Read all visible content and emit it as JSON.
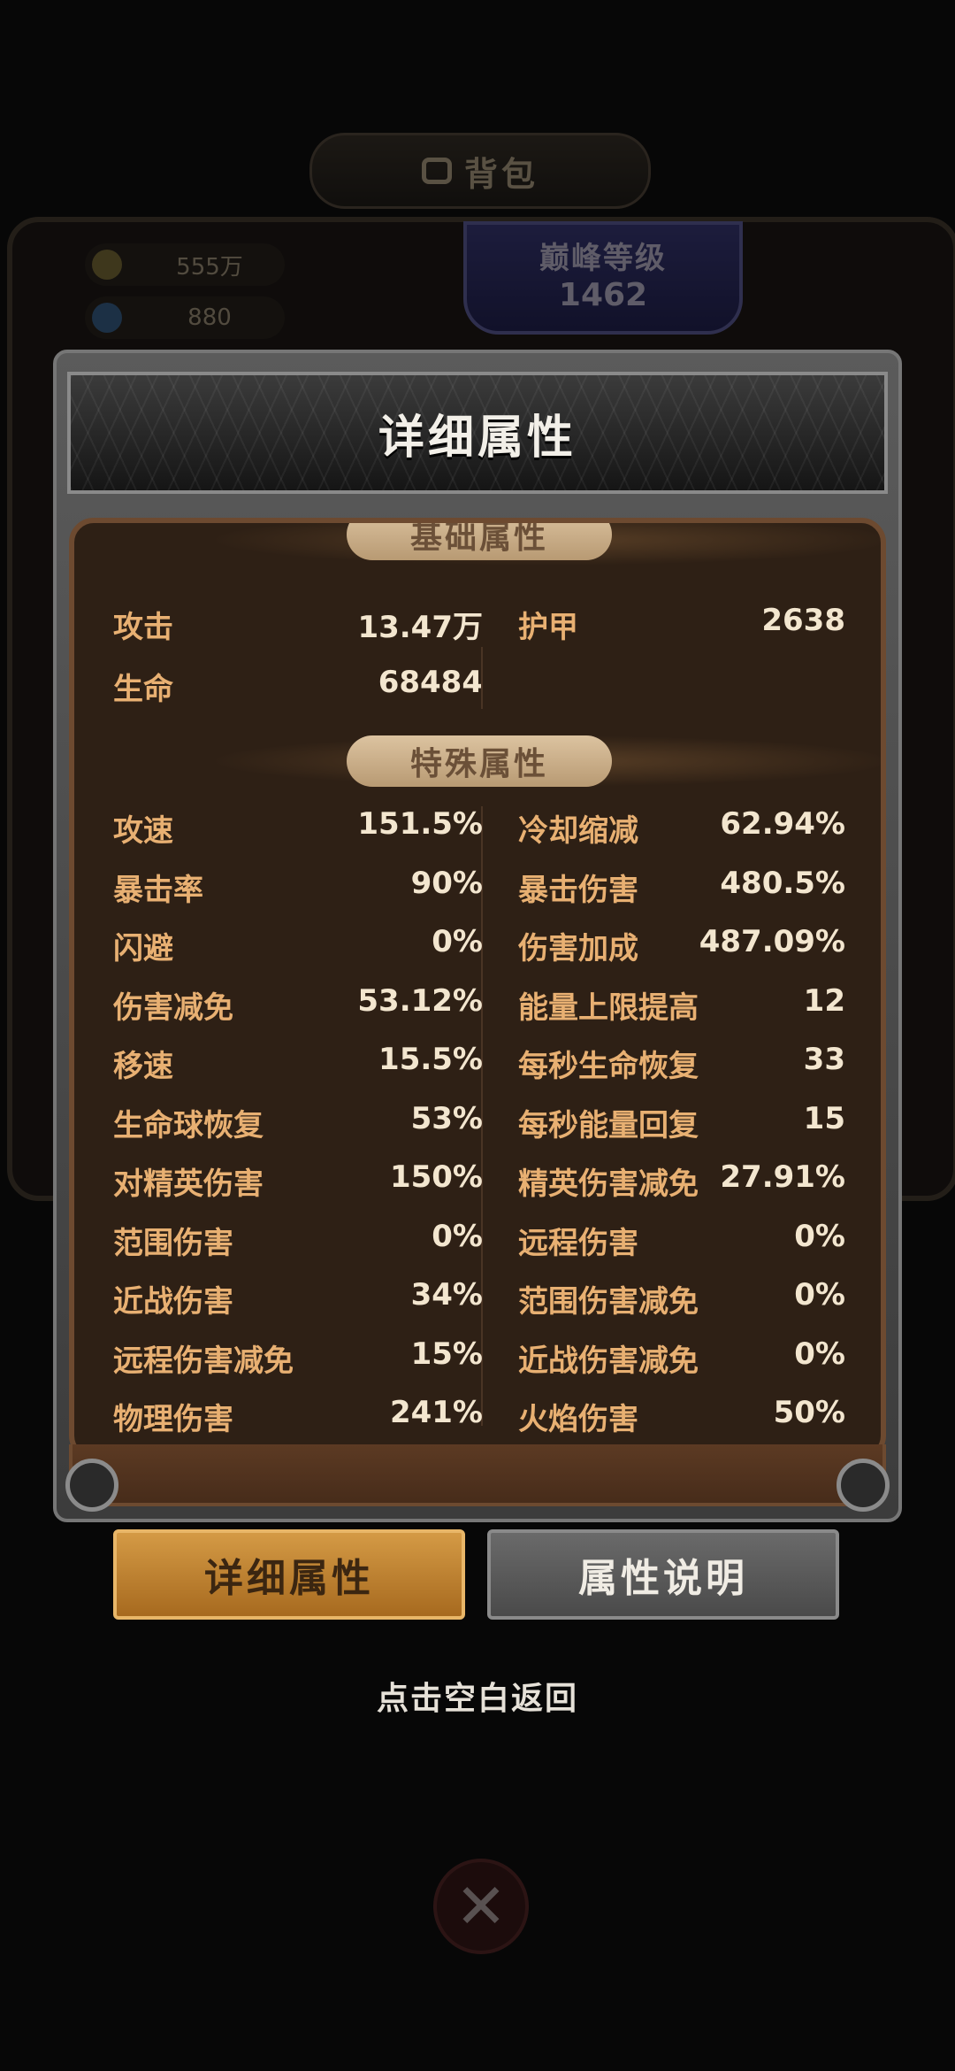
{
  "background": {
    "header_title": "背包",
    "gold": "555万",
    "gems": "880",
    "level_title": "巅峰等级",
    "level_value": "1462"
  },
  "panel": {
    "title": "详细属性",
    "basic_header": "基础属性",
    "special_header": "特殊属性"
  },
  "basic_stats": [
    {
      "label": "攻击",
      "value": "13.47万"
    },
    {
      "label": "护甲",
      "value": "2638"
    },
    {
      "label": "生命",
      "value": "68484"
    }
  ],
  "special_stats_left": [
    {
      "label": "攻速",
      "value": "151.5%"
    },
    {
      "label": "暴击率",
      "value": "90%"
    },
    {
      "label": "闪避",
      "value": "0%"
    },
    {
      "label": "伤害减免",
      "value": "53.12%"
    },
    {
      "label": "移速",
      "value": "15.5%"
    },
    {
      "label": "生命球恢复",
      "value": "53%"
    },
    {
      "label": "对精英伤害",
      "value": "150%"
    },
    {
      "label": "范围伤害",
      "value": "0%"
    },
    {
      "label": "近战伤害",
      "value": "34%"
    },
    {
      "label": "远程伤害减免",
      "value": "15%"
    },
    {
      "label": "物理伤害",
      "value": "241%"
    }
  ],
  "special_stats_right": [
    {
      "label": "冷却缩减",
      "value": "62.94%"
    },
    {
      "label": "暴击伤害",
      "value": "480.5%"
    },
    {
      "label": "伤害加成",
      "value": "487.09%"
    },
    {
      "label": "能量上限提高",
      "value": "12"
    },
    {
      "label": "每秒生命恢复",
      "value": "33"
    },
    {
      "label": "每秒能量回复",
      "value": "15"
    },
    {
      "label": "精英伤害减免",
      "value": "27.91%"
    },
    {
      "label": "远程伤害",
      "value": "0%"
    },
    {
      "label": "范围伤害减免",
      "value": "0%"
    },
    {
      "label": "近战伤害减免",
      "value": "0%"
    },
    {
      "label": "火焰伤害",
      "value": "50%"
    }
  ],
  "buttons": {
    "detail": "详细属性",
    "explain": "属性说明"
  },
  "hint": "点击空白返回",
  "colors": {
    "label": "#e8b072",
    "value": "#f3e6cf",
    "active_button": "#d49a45",
    "inactive_button": "#6a6a6a"
  }
}
